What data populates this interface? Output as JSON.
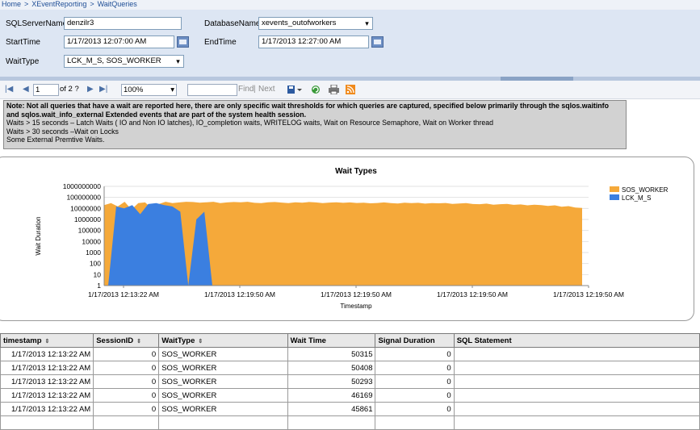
{
  "breadcrumb": [
    "Home",
    "XEventReporting",
    "WaitQueries"
  ],
  "breadcrumb_sep": ">",
  "params": {
    "sqlservername_label": "SQLServerName",
    "sqlservername_value": "denzilr3",
    "databasename_label": "DatabaseName",
    "databasename_value": "xevents_outofworkers",
    "starttime_label": "StartTime",
    "starttime_value": "1/17/2013 12:07:00 AM",
    "endtime_label": "EndTime",
    "endtime_value": "1/17/2013 12:27:00 AM",
    "waittype_label": "WaitType",
    "waittype_value": "LCK_M_S, SOS_WORKER"
  },
  "toolbar": {
    "page_value": "1",
    "page_of": "of 2 ?",
    "zoom": "100%",
    "find_label": "Find",
    "next_label": "Next"
  },
  "note": {
    "bold_prefix": "Note:",
    "line1": " Not all queries that have a wait are reported here, there are only specific wait thresholds for which queries are captured, specified below primarily through the sqlos.waitinfo and sqlos.wait_info_external Extended events that are part of the system health session.",
    "line2": "Waits > 15 seconds – Latch Waits ( IO and Non IO latches), IO_completion waits, WRITELOG waits, Wait on Resource Semaphore, Wait on Worker thread",
    "line3": "Waits > 30 seconds –Wait on Locks",
    "line4": "Some External Premtive Waits."
  },
  "chart_data": {
    "type": "area",
    "title": "Wait Types",
    "xlabel": "Timestamp",
    "ylabel": "Wait Duration",
    "y_scale": "log",
    "ylim": [
      1,
      1000000000
    ],
    "y_ticks": [
      "1000000000",
      "100000000",
      "10000000",
      "1000000",
      "100000",
      "10000",
      "1000",
      "100",
      "10",
      "1"
    ],
    "x_ticks": [
      "1/17/2013 12:13:22 AM",
      "1/17/2013 12:19:50 AM",
      "1/17/2013 12:19:50 AM",
      "1/17/2013 12:19:50 AM",
      "1/17/2013 12:19:50 AM"
    ],
    "legend_position": "right",
    "series": [
      {
        "name": "SOS_WORKER",
        "color": "#f5a93a",
        "values": [
          20000000,
          30000000,
          15000000,
          40000000,
          8000000,
          30000000,
          35000000,
          10000000,
          25000000,
          40000000,
          30000000,
          35000000,
          40000000,
          38000000,
          33000000,
          36000000,
          40000000,
          30000000,
          35000000,
          38000000,
          36000000,
          40000000,
          32000000,
          30000000,
          36000000,
          38000000,
          34000000,
          30000000,
          36000000,
          33000000,
          38000000,
          35000000,
          30000000,
          34000000,
          36000000,
          32000000,
          35000000,
          31000000,
          33000000,
          29000000,
          31000000,
          35000000,
          30000000,
          28000000,
          33000000,
          30000000,
          32000000,
          27000000,
          30000000,
          29000000,
          31000000,
          26000000,
          28000000,
          30000000,
          25000000,
          24000000,
          27000000,
          22000000,
          24000000,
          26000000,
          21000000,
          23000000,
          19000000,
          22000000,
          20000000,
          17000000,
          19000000,
          14000000,
          16000000,
          12000000,
          11000000
        ]
      },
      {
        "name": "LCK_M_S",
        "color": "#3b7fe0",
        "values": [
          0,
          15000000,
          10000000,
          20000000,
          3000000,
          25000000,
          30000000,
          20000000,
          15000000,
          5000000,
          0,
          1000000,
          5000000,
          0
        ]
      }
    ]
  },
  "table": {
    "columns": [
      "timestamp",
      "SessionID",
      "WaitType",
      "Wait Time",
      "Signal Duration",
      "SQL Statement"
    ],
    "rows": [
      [
        "1/17/2013 12:13:22 AM",
        "0",
        "SOS_WORKER",
        "50315",
        "0",
        ""
      ],
      [
        "1/17/2013 12:13:22 AM",
        "0",
        "SOS_WORKER",
        "50408",
        "0",
        ""
      ],
      [
        "1/17/2013 12:13:22 AM",
        "0",
        "SOS_WORKER",
        "50293",
        "0",
        ""
      ],
      [
        "1/17/2013 12:13:22 AM",
        "0",
        "SOS_WORKER",
        "46169",
        "0",
        ""
      ],
      [
        "1/17/2013 12:13:22 AM",
        "0",
        "SOS_WORKER",
        "45861",
        "0",
        ""
      ],
      [
        "",
        "",
        "",
        "",
        "",
        ""
      ]
    ]
  }
}
